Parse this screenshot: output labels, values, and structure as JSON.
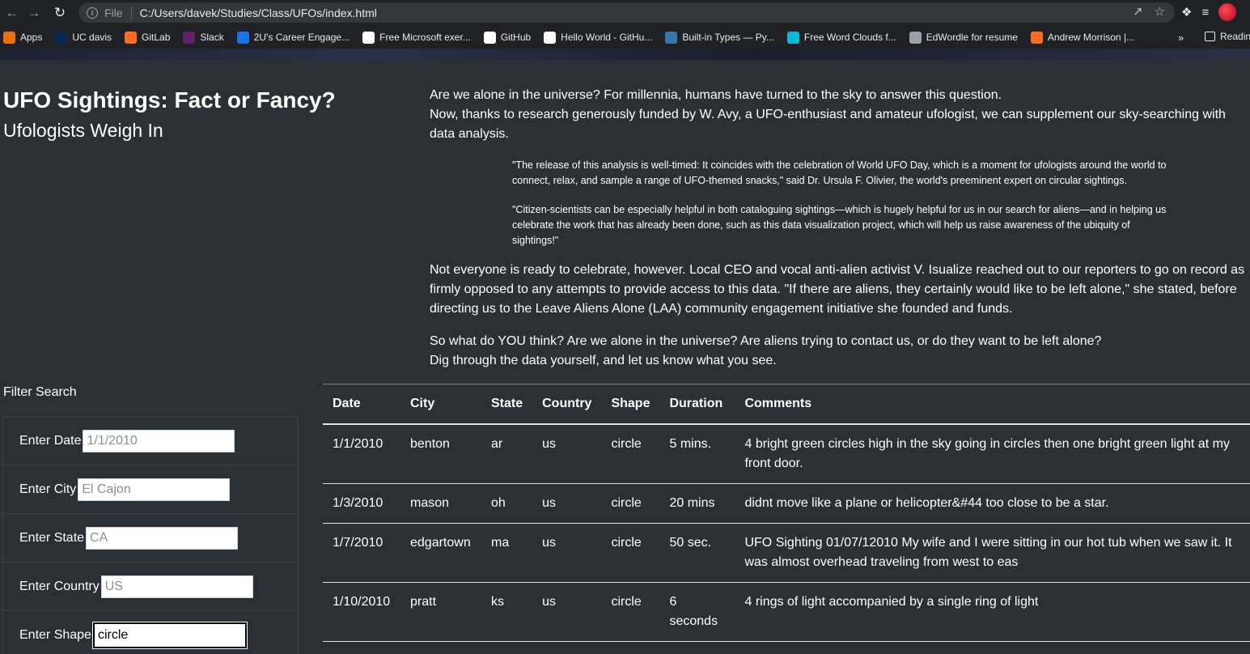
{
  "browser": {
    "url_scheme": "File",
    "url": "C:/Users/davek/Studies/Class/UFOs/index.html",
    "bookmarks": [
      {
        "label": "Apps",
        "icon": "apps-grid-icon",
        "color": "#e8710a"
      },
      {
        "label": "UC davis",
        "icon": "ucdavis-icon",
        "color": "#022851"
      },
      {
        "label": "GitLab",
        "icon": "gitlab-icon",
        "color": "#fc6d26"
      },
      {
        "label": "Slack",
        "icon": "slack-icon",
        "color": "#611f69"
      },
      {
        "label": "2U's Career Engage...",
        "icon": "2u-icon",
        "color": "#1a73e8"
      },
      {
        "label": "Free Microsoft exer...",
        "icon": "page-icon",
        "color": "#ffffff"
      },
      {
        "label": "GitHub",
        "icon": "github-icon",
        "color": "#ffffff"
      },
      {
        "label": "Hello World - GitHu...",
        "icon": "github-icon",
        "color": "#ffffff"
      },
      {
        "label": "Built-in Types — Py...",
        "icon": "python-icon",
        "color": "#3776ab"
      },
      {
        "label": "Free Word Clouds f...",
        "icon": "wordcloud-icon",
        "color": "#00bcd4"
      },
      {
        "label": "EdWordle for resume",
        "icon": "globe-icon",
        "color": "#9aa0a6"
      },
      {
        "label": "Andrew Morrison |...",
        "icon": "gitlab-icon",
        "color": "#fc6d26"
      }
    ],
    "more": "»",
    "reading_list": "Readin"
  },
  "header": {
    "title": "UFO Sightings: Fact or Fancy?",
    "subtitle": "Ufologists Weigh In"
  },
  "intro": {
    "line1": "Are we alone in the universe? For millennia, humans have turned to the sky to answer this question.",
    "line2": "Now, thanks to research generously funded by W. Avy, a UFO-enthusiast and amateur ufologist, we can supplement our sky-searching with data analysis.",
    "quote1": "\"The release of this analysis is well-timed: It coincides with the celebration of World UFO Day, which is a moment for ufologists around the world to connect, relax, and sample a range of UFO-themed snacks,\" said Dr. Ursula F. Olivier, the world's preeminent expert on circular sightings.",
    "quote2": "\"Citizen-scientists can be especially helpful in both cataloguing sightings—which is hugely helpful for us in our search for aliens—and in helping us celebrate the work that has already been done, such as this data visualization project, which will help us raise awareness of the ubiquity of sightings!\"",
    "para3": "Not everyone is ready to celebrate, however. Local CEO and vocal anti-alien activist V. Isualize reached out to our reporters to go on record as firmly opposed to any attempts to provide access to this data. \"If there are aliens, they certainly would like to be left alone,\" she stated, before directing us to the Leave Aliens Alone (LAA) community engagement initiative she founded and funds.",
    "para4a": "So what do YOU think? Are we alone in the universe? Are aliens trying to contact us, or do they want to be left alone?",
    "para4b": "Dig through the data yourself, and let us know what you see."
  },
  "filters": {
    "title": "Filter Search",
    "items": [
      {
        "label": "Enter Date",
        "placeholder": "1/1/2010",
        "value": ""
      },
      {
        "label": "Enter City",
        "placeholder": "El Cajon",
        "value": ""
      },
      {
        "label": "Enter State",
        "placeholder": "CA",
        "value": ""
      },
      {
        "label": "Enter Country",
        "placeholder": "US",
        "value": ""
      },
      {
        "label": "Enter Shape",
        "placeholder": "",
        "value": "circle"
      }
    ]
  },
  "table": {
    "headers": [
      "Date",
      "City",
      "State",
      "Country",
      "Shape",
      "Duration",
      "Comments"
    ],
    "rows": [
      [
        "1/1/2010",
        "benton",
        "ar",
        "us",
        "circle",
        "5 mins.",
        "4 bright green circles high in the sky going in circles then one bright green light at my front door."
      ],
      [
        "1/3/2010",
        "mason",
        "oh",
        "us",
        "circle",
        "20 mins",
        "didnt move like a plane or helicopter&#44 too close to be a star."
      ],
      [
        "1/7/2010",
        "edgartown",
        "ma",
        "us",
        "circle",
        "50 sec.",
        "UFO Sighting 01/07/12010 My wife and I were sitting in our hot tub when we saw it. It was almost overhead traveling from west to eas"
      ],
      [
        "1/10/2010",
        "pratt",
        "ks",
        "us",
        "circle",
        "6 seconds",
        "4 rings of light accompanied by a single ring of light"
      ]
    ]
  }
}
